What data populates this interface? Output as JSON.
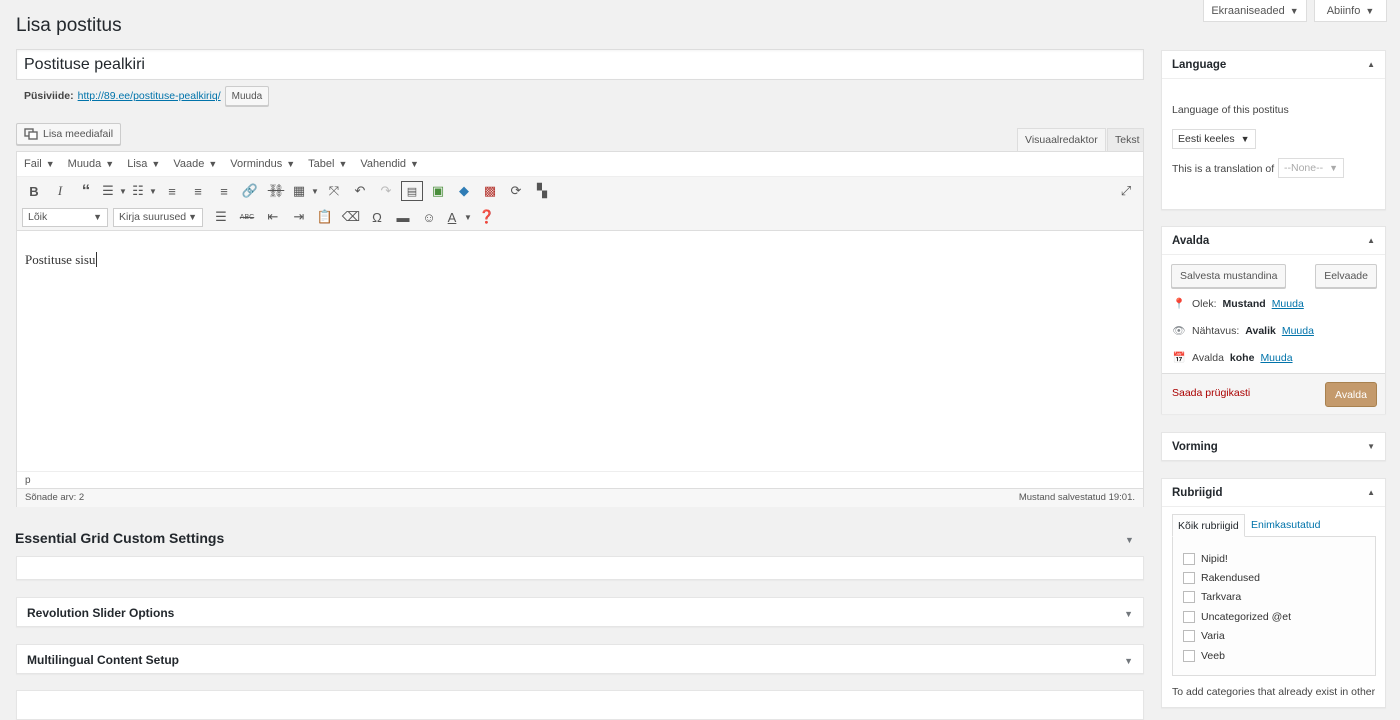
{
  "screen_meta": {
    "screen_options": "Ekraaniseaded",
    "help": "Abiinfo"
  },
  "page_title": "Lisa postitus",
  "post_title": "Postituse pealkiri",
  "permalink": {
    "label": "Püsiviide:",
    "url": "http://89.ee/postituse-pealkiriq/",
    "edit": "Muuda"
  },
  "add_media": "Lisa meediafail",
  "editor_tabs": {
    "visual": "Visuaalredaktor",
    "text": "Tekst"
  },
  "menubar": [
    "Fail",
    "Muuda",
    "Lisa",
    "Vaade",
    "Vormindus",
    "Tabel",
    "Vahendid"
  ],
  "toolbar2": {
    "format_select": "Lõik",
    "font_size_select": "Kirja suurused"
  },
  "content": "Postituse sisu",
  "path": "p",
  "word_count": "Sõnade arv: 2",
  "draft_status": "Mustand salvestatud 19:01.",
  "metaboxes": {
    "essential_grid": "Essential Grid Custom Settings",
    "revolution": "Revolution Slider Options",
    "multilingual": "Multilingual Content Setup"
  },
  "language_box": {
    "title": "Language",
    "label": "Language of this postitus",
    "selected": "Eesti keeles",
    "translation_label": "This is a translation of",
    "translation_value": "--None--"
  },
  "publish_box": {
    "title": "Avalda",
    "save_draft": "Salvesta mustandina",
    "preview": "Eelvaade",
    "status_label": "Olek:",
    "status_value": "Mustand",
    "visibility_label": "Nähtavus:",
    "visibility_value": "Avalik",
    "schedule_label": "Avalda",
    "schedule_value": "kohe",
    "edit": "Muuda",
    "trash": "Saada prügikasti",
    "publish": "Avalda"
  },
  "format_box": {
    "title": "Vorming"
  },
  "categories_box": {
    "title": "Rubriigid",
    "tab_all": "Kõik rubriigid",
    "tab_popular": "Enimkasutatud",
    "items": [
      "Nipid!",
      "Rakendused",
      "Tarkvara",
      "Uncategorized @et",
      "Varia",
      "Veeb"
    ],
    "footer": "To add categories that already exist in other"
  },
  "colors": {
    "accent": "#0073aa",
    "publish_btn": "#c49a6c",
    "trash": "#a00"
  }
}
